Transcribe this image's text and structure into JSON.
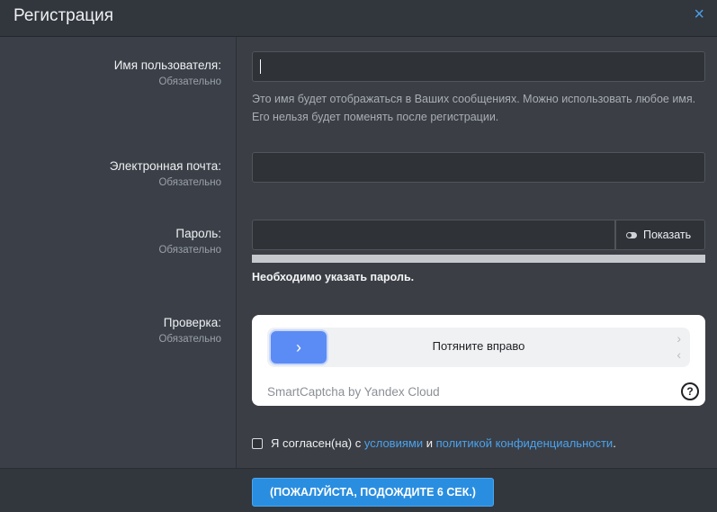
{
  "dialog": {
    "title": "Регистрация",
    "close_icon": "×"
  },
  "fields": {
    "username": {
      "label": "Имя пользователя:",
      "required": "Обязательно",
      "value": "",
      "hint": "Это имя будет отображаться в Ваших сообщениях. Можно использовать любое имя. Его нельзя будет поменять после регистрации."
    },
    "email": {
      "label": "Электронная почта:",
      "required": "Обязательно",
      "value": ""
    },
    "password": {
      "label": "Пароль:",
      "required": "Обязательно",
      "value": "",
      "show_label": "Показать",
      "error": "Необходимо указать пароль."
    },
    "captcha": {
      "label": "Проверка:",
      "required": "Обязательно",
      "slider_text": "Потяните вправо",
      "brand": "SmartCaptcha by Yandex Cloud",
      "handle_icon": "chevron-right-icon",
      "help_icon": "?"
    }
  },
  "agree": {
    "checked": false,
    "prefix": "Я согласен(на) с ",
    "terms_link": "условиями",
    "middle": " и ",
    "privacy_link": "политикой конфиденциальности",
    "suffix": "."
  },
  "footer": {
    "submit_label": "(ПОЖАЛУЙСТА, ПОДОЖДИТЕ 6 СЕК.)"
  },
  "colors": {
    "accent": "#2a8ee0",
    "link": "#4aa3f0",
    "captcha_handle": "#5b8cf5"
  }
}
